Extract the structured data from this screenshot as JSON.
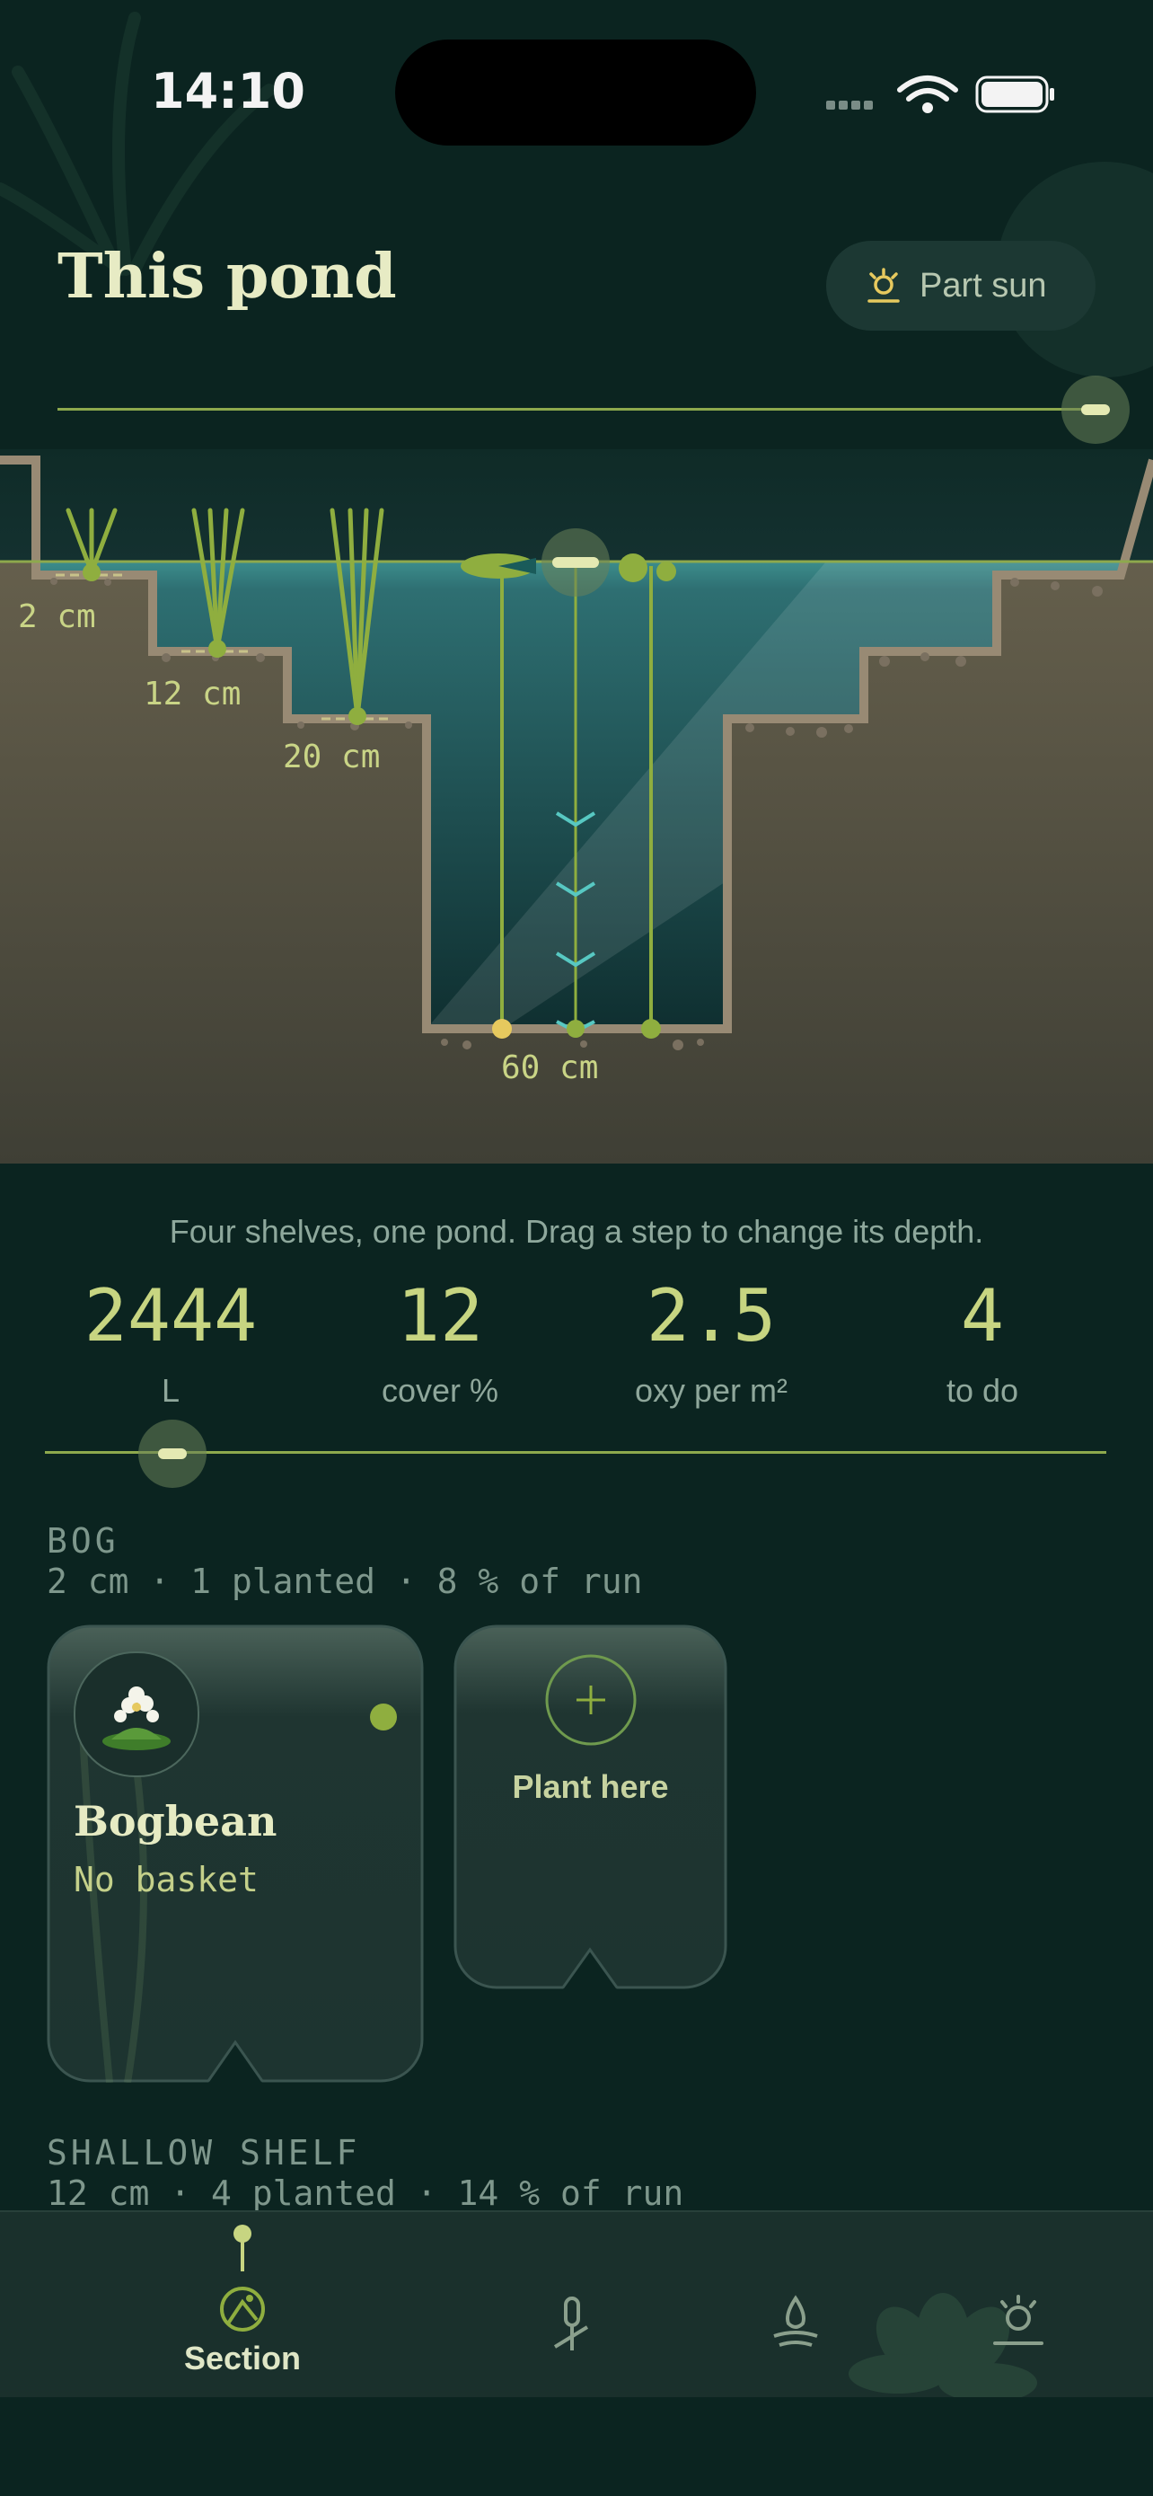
{
  "status": {
    "time": "14:10"
  },
  "header": {
    "title": "This pond",
    "sun_label": "Part sun"
  },
  "profile": {
    "shelves": [
      {
        "depth_label": "2 cm"
      },
      {
        "depth_label": "12 cm"
      },
      {
        "depth_label": "20 cm"
      },
      {
        "depth_label": "60 cm"
      }
    ]
  },
  "caption": "Four shelves, one pond. Drag a step to change its depth.",
  "stats": [
    {
      "value": "2444",
      "label": "L"
    },
    {
      "value": "12",
      "label": "cover %"
    },
    {
      "value": "2.5",
      "label": "oxy per m²"
    },
    {
      "value": "4",
      "label": "to do"
    }
  ],
  "sections": [
    {
      "title": "BOG",
      "subtitle": "2 cm · 1 planted · 8 % of run",
      "cards": [
        {
          "name": "Bogbean",
          "sub": "No basket"
        }
      ],
      "add_label": "Plant here"
    },
    {
      "title": "SHALLOW SHELF",
      "subtitle": "12 cm · 4 planted · 14 % of run"
    }
  ],
  "tabs": [
    {
      "label": "Section",
      "icon": "section-icon",
      "active": true
    },
    {
      "label": "",
      "icon": "reed-icon"
    },
    {
      "label": "",
      "icon": "water-drop-icon"
    },
    {
      "label": "",
      "icon": "sun-icon"
    }
  ],
  "colors": {
    "accent": "#c7d581",
    "background": "#0b2420",
    "water": "#2d6f72",
    "soil": "#5c5747"
  }
}
